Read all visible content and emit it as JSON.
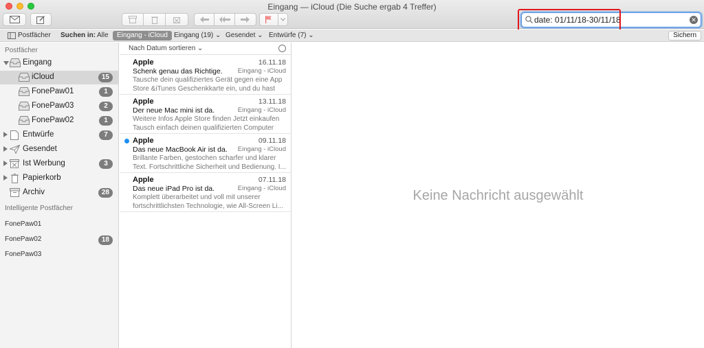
{
  "window": {
    "title": "Eingang — iCloud (Die Suche ergab 4 Treffer)"
  },
  "search": {
    "value": "date: 01/11/18-30/11/18"
  },
  "scope_bar": {
    "mailboxes_label": "Postfächer",
    "search_in_label": "Suchen in:",
    "all_label": "Alle",
    "active_scope": "Eingang - iCloud",
    "inbox_scope": "Eingang (19)",
    "sent_scope": "Gesendet",
    "drafts_scope": "Entwürfe (7)",
    "save_label": "Sichern"
  },
  "sidebar": {
    "section_mailboxes": "Postfächer",
    "inbox": {
      "label": "Eingang"
    },
    "accounts": [
      {
        "label": "iCloud",
        "count": "15"
      },
      {
        "label": "FonePaw01",
        "count": "1"
      },
      {
        "label": "FonePaw03",
        "count": "2"
      },
      {
        "label": "FonePaw02",
        "count": "1"
      }
    ],
    "folders": [
      {
        "label": "Entwürfe",
        "count": "7"
      },
      {
        "label": "Gesendet",
        "count": ""
      },
      {
        "label": "Ist Werbung",
        "count": "3"
      },
      {
        "label": "Papierkorb",
        "count": ""
      },
      {
        "label": "Archiv",
        "count": "28"
      }
    ],
    "section_smart": "Intelligente Postfächer",
    "smart": [
      {
        "label": "FonePaw01",
        "count": ""
      },
      {
        "label": "FonePaw02",
        "count": "18"
      },
      {
        "label": "FonePaw03",
        "count": ""
      }
    ]
  },
  "message_list": {
    "sort_label": "Nach Datum sortieren",
    "messages": [
      {
        "from": "Apple",
        "date": "16.11.18",
        "subject": "Schenk genau das Richtige.",
        "mailbox": "Eingang - iCloud",
        "preview": "Tausche dein qualifiziertes Gerät gegen eine App Store &iTunes Geschenkkarte ein, und du hast no..."
      },
      {
        "from": "Apple",
        "date": "13.11.18",
        "subject": "Der neue Mac mini ist da.",
        "mailbox": "Eingang - iCloud",
        "preview": "Weitere Infos Apple Store finden Jetzt einkaufen Tausch einfach deinen qualifizierten Computer ei..."
      },
      {
        "from": "Apple",
        "date": "09.11.18",
        "subject": "Das neue MacBook Air ist da.",
        "mailbox": "Eingang - iCloud",
        "preview": "Brillante Farben, gestochen scharfer und klarer Text. Fortschrittliche Sicherheit und Bedienung. I..."
      },
      {
        "from": "Apple",
        "date": "07.11.18",
        "subject": "Das neue iPad Pro ist da.",
        "mailbox": "Eingang - iCloud",
        "preview": "Komplett überarbeitet und voll mit unserer fortschrittlichsten Technologie, wie All-Screen Li..."
      }
    ]
  },
  "reader": {
    "empty_text": "Keine Nachricht ausgewählt"
  },
  "colors": {
    "unread_dot": "#1e8ff1",
    "highlight_box": "#e0161d",
    "badge": "#7d7d7d"
  }
}
